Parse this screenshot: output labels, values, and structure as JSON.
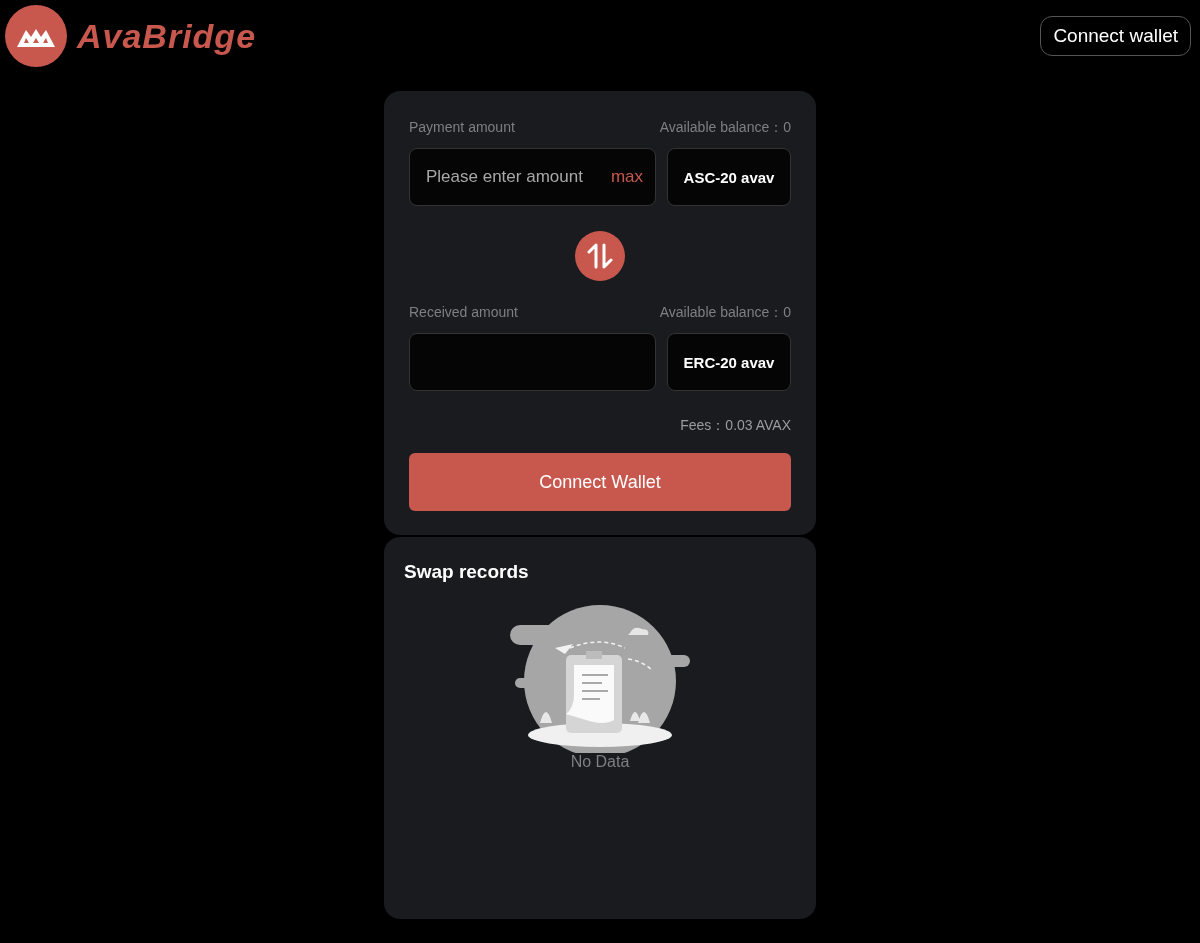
{
  "header": {
    "brand": "AvaBridge",
    "connect_button": "Connect wallet"
  },
  "swap": {
    "sections": [
      {
        "label": "Payment amount",
        "balance": "Available balance：0",
        "placeholder": "Please enter amount",
        "max": "max",
        "token": "ASC-20 avav"
      },
      {
        "label": "Received amount",
        "balance": "Available balance：0",
        "token": "ERC-20 avav"
      }
    ],
    "fees": "Fees：0.03 AVAX",
    "submit": "Connect Wallet"
  },
  "records": {
    "title": "Swap records",
    "empty_text": "No Data"
  }
}
